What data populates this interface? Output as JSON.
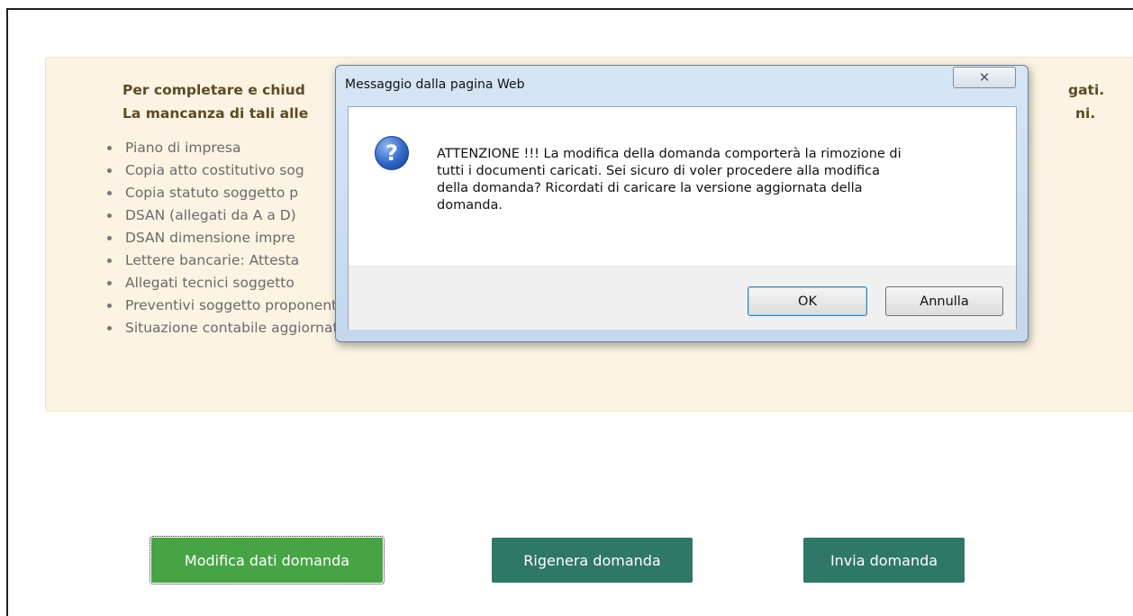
{
  "info": {
    "intro_line1": "Per completare e chiud",
    "intro_line1_tail": "gati.",
    "intro_line2": "La mancanza di tali alle",
    "intro_line2_tail": "ni.",
    "items": [
      "Piano di impresa",
      "Copia atto costitutivo sog",
      "Copia statuto soggetto p",
      "DSAN (allegati da A a D)",
      "DSAN dimensione impre",
      "Lettere bancarie: Attesta",
      "Allegati tecnici soggetto",
      "Preventivi soggetto proponente",
      "Situazione contabile aggiornata"
    ]
  },
  "buttons": {
    "modifica": "Modifica dati domanda",
    "rigenera": "Rigenera domanda",
    "invia": "Invia domanda"
  },
  "dialog": {
    "title": "Messaggio dalla pagina Web",
    "close_glyph": "✕",
    "icon_glyph": "?",
    "icon": "question-icon",
    "message_lines": [
      "ATTENZIONE !!! La modifica della domanda comporterà la rimozione di",
      "tutti i documenti caricati. Sei sicuro di voler procedere alla modifica",
      "della domanda? Ricordati di caricare la versione aggiornata della",
      "domanda."
    ],
    "ok_label": "OK",
    "cancel_label": "Annulla"
  },
  "colors": {
    "panel_bg": "#fbf4e3",
    "primary_green": "#47a445",
    "dark_teal": "#2f7767"
  }
}
